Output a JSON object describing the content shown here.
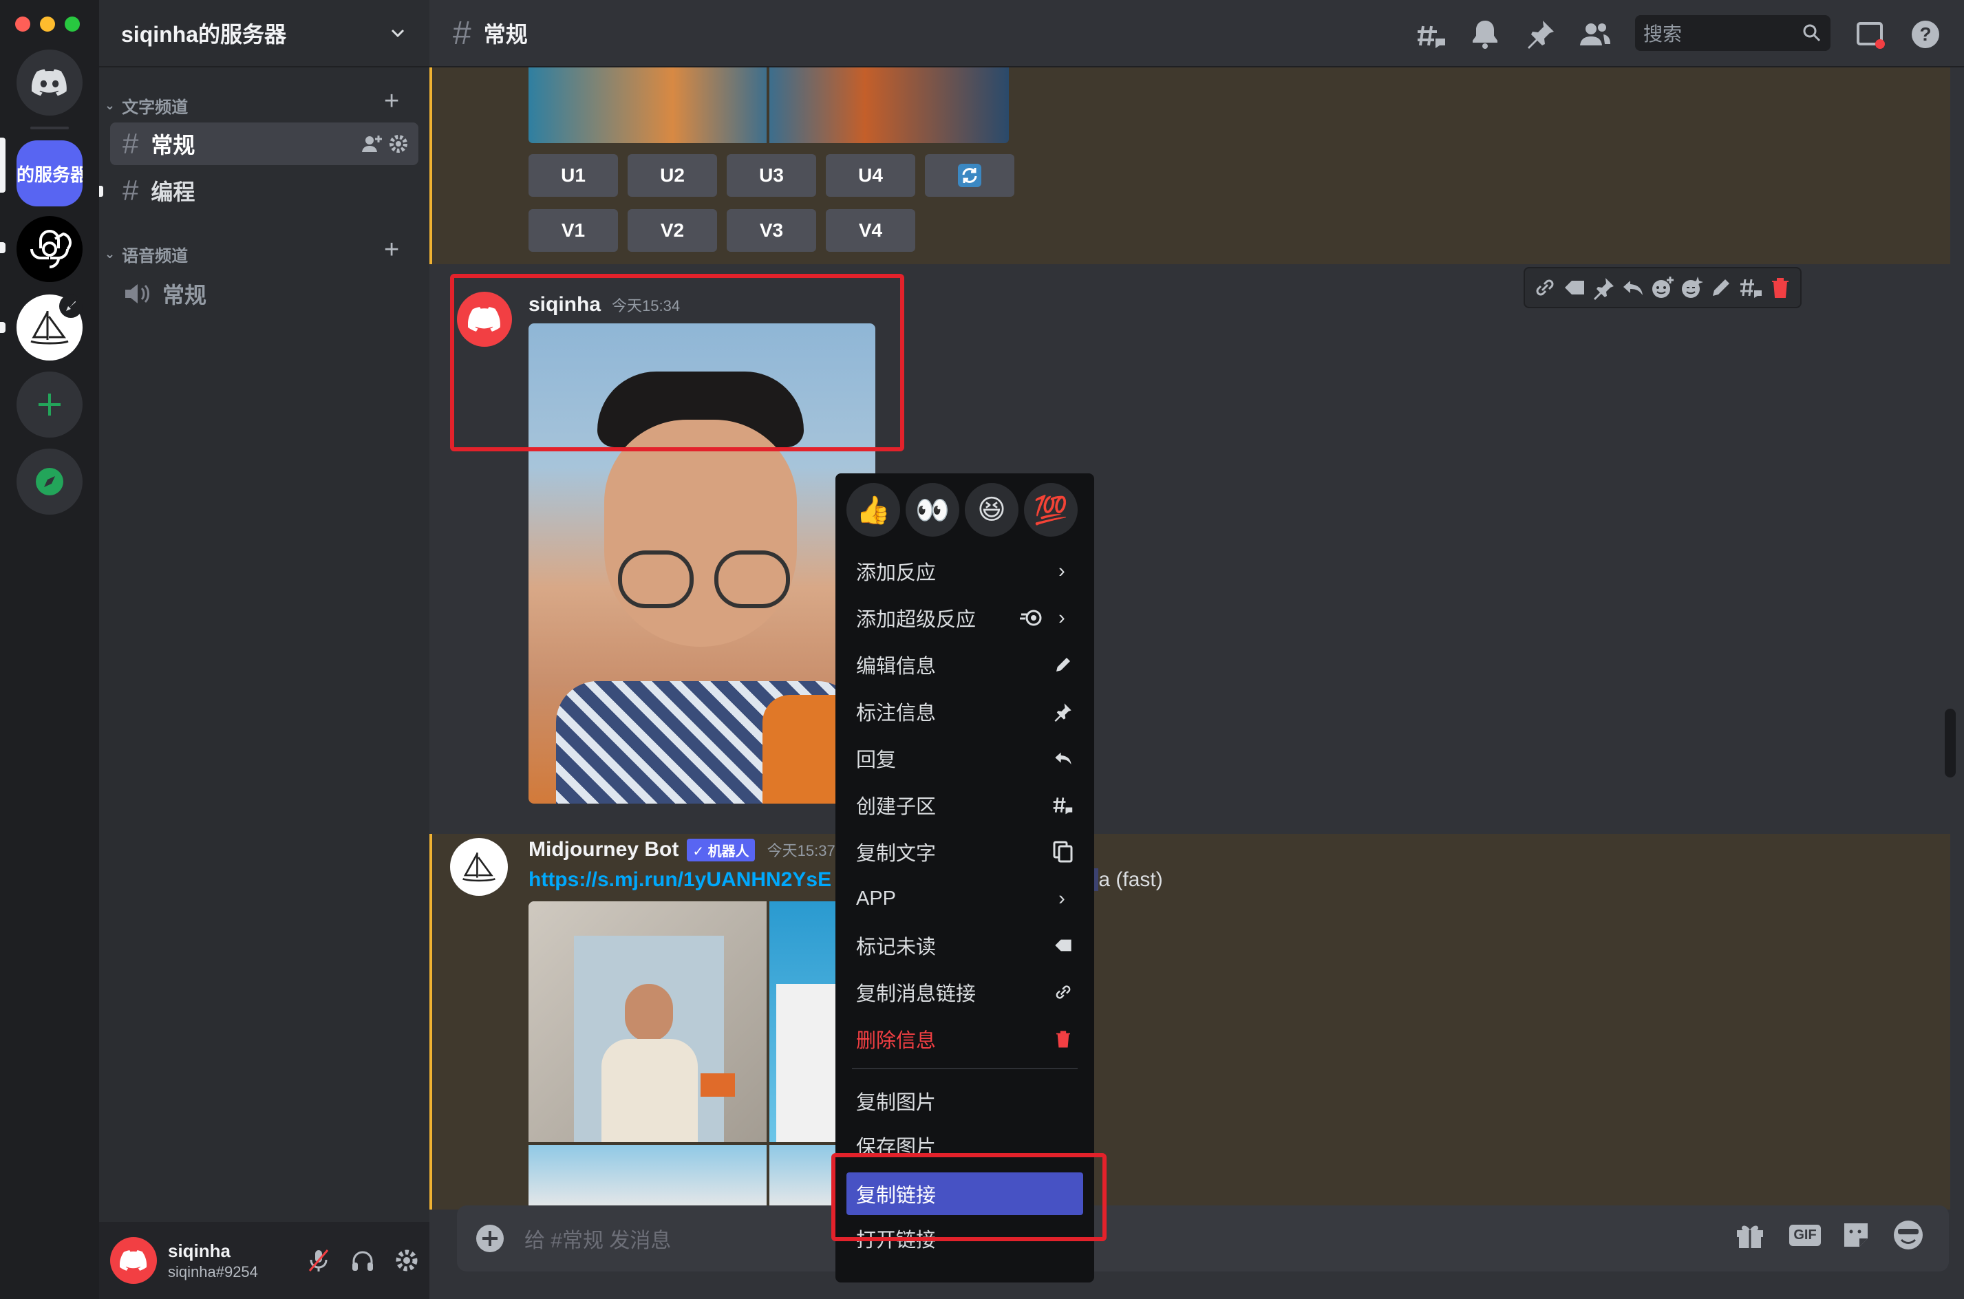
{
  "window": {
    "traffic_lights": [
      "#ff5f57",
      "#febc2e",
      "#28c840"
    ]
  },
  "rail": {
    "server_abbrev": "的服务器",
    "icons": [
      "discord-home-icon",
      "openai-icon",
      "midjourney-sailboat-icon",
      "add-server-icon",
      "explore-compass-icon"
    ]
  },
  "sidebar": {
    "server_name": "siqinha的服务器",
    "text_category": "文字频道",
    "voice_category": "语音频道",
    "channels": [
      {
        "label": "常规"
      },
      {
        "label": "编程"
      }
    ],
    "voice_channels": [
      {
        "label": "常规"
      }
    ]
  },
  "header": {
    "channel": "常规",
    "search_placeholder": "搜索"
  },
  "messages": {
    "buttons_u": [
      "U1",
      "U2",
      "U3",
      "U4"
    ],
    "buttons_v": [
      "V1",
      "V2",
      "V3",
      "V4"
    ],
    "msg1": {
      "author": "siqinha",
      "time": "今天15:34"
    },
    "msg2": {
      "author": "Midjourney Bot",
      "badge": "✓ 机器人",
      "time": "今天15:37",
      "link": "https://s.mj.run/1yUANHN2YsE",
      "suffix": "a (fast)"
    }
  },
  "context_menu": {
    "reactions": [
      "👍",
      "👀",
      "😆",
      "💯"
    ],
    "items": [
      {
        "label": "添加反应",
        "icon": "chevron-right-icon"
      },
      {
        "label": "添加超级反应",
        "icon": "super-reaction-icon"
      },
      {
        "label": "编辑信息",
        "icon": "pencil-icon"
      },
      {
        "label": "标注信息",
        "icon": "pin-icon"
      },
      {
        "label": "回复",
        "icon": "reply-icon"
      },
      {
        "label": "创建子区",
        "icon": "thread-icon"
      },
      {
        "label": "复制文字",
        "icon": "copy-icon"
      },
      {
        "label": "APP",
        "icon": "chevron-right-icon"
      },
      {
        "label": "标记未读",
        "icon": "mark-unread-icon"
      },
      {
        "label": "复制消息链接",
        "icon": "link-icon"
      },
      {
        "label": "删除信息",
        "icon": "trash-icon"
      },
      {
        "label": "复制图片",
        "icon": ""
      },
      {
        "label": "保存图片",
        "icon": ""
      },
      {
        "label": "复制链接",
        "icon": ""
      },
      {
        "label": "打开链接",
        "icon": ""
      }
    ]
  },
  "composer": {
    "placeholder": "给 #常规 发消息"
  },
  "user": {
    "name": "siqinha",
    "tag": "siqinha#9254"
  },
  "colors": {
    "accent": "#5865f2",
    "highlight": "#40392d",
    "danger": "#f23f43",
    "menu_active": "#4752c4",
    "annotation": "#e3222b"
  }
}
